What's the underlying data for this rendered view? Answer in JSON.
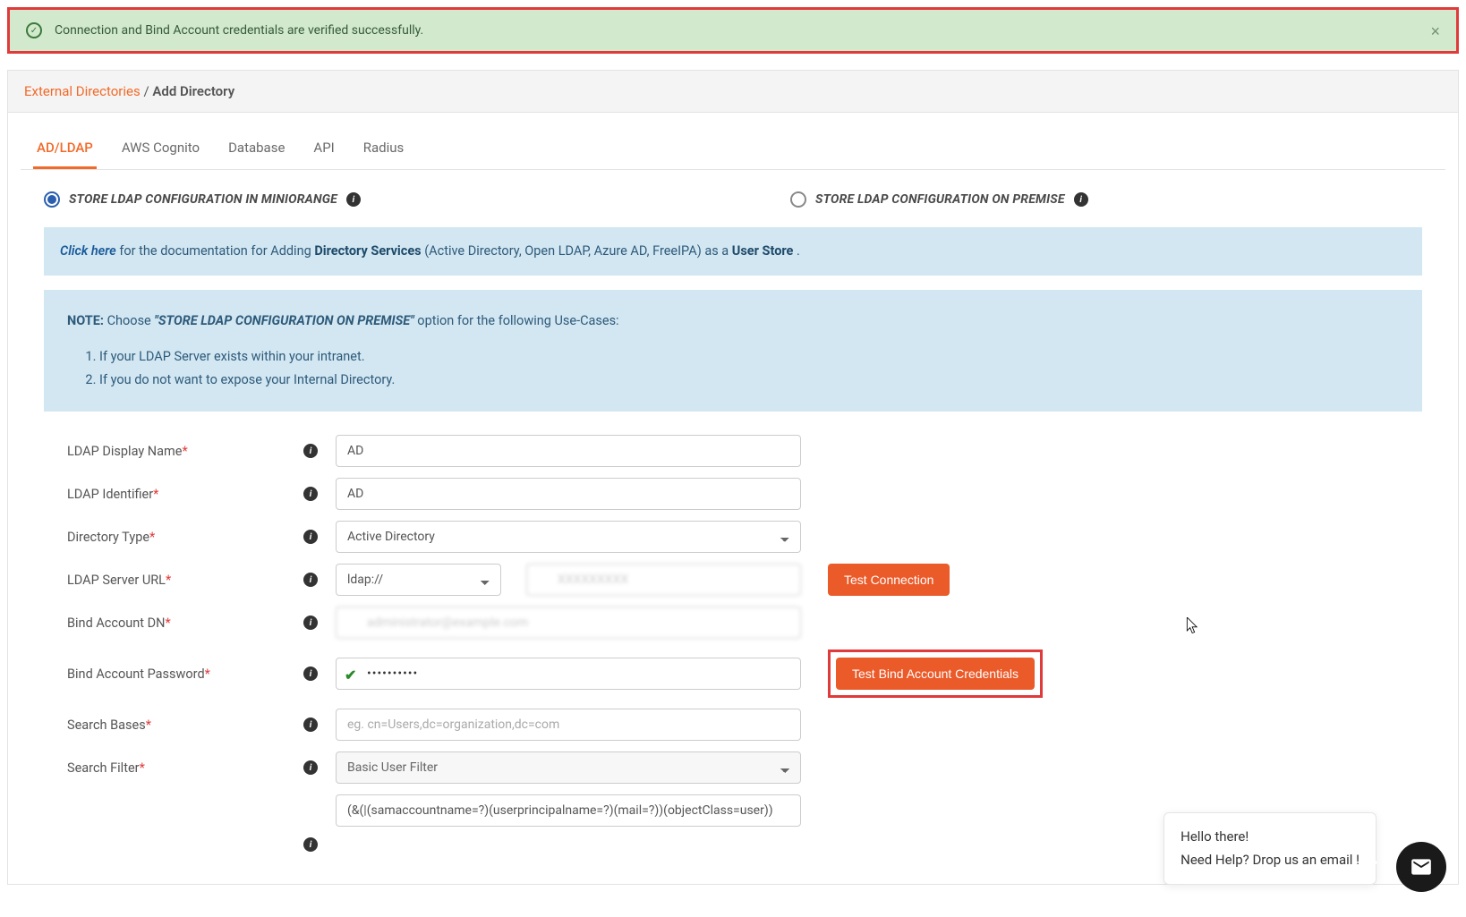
{
  "alert": {
    "text": "Connection and Bind Account credentials are verified successfully."
  },
  "breadcrumb": {
    "parent": "External Directories",
    "sep": " / ",
    "current": "Add Directory"
  },
  "tabs": [
    "AD/LDAP",
    "AWS Cognito",
    "Database",
    "API",
    "Radius"
  ],
  "radio": {
    "miniorange": "STORE LDAP CONFIGURATION IN MINIORANGE",
    "onprem": "STORE LDAP CONFIGURATION ON PREMISE"
  },
  "docbox": {
    "click_here": "Click here",
    "text1": " for the documentation for Adding ",
    "dir_services": "Directory Services",
    "text2": " (Active Directory, Open LDAP, Azure AD, FreeIPA) as a ",
    "user_store": "User Store",
    "text3": "."
  },
  "notebox": {
    "note_label": "NOTE:",
    "choose": "  Choose ",
    "emph": "\"STORE LDAP CONFIGURATION ON PREMISE\"",
    "after": " option for the following Use-Cases:",
    "li1": "If your LDAP Server exists within your intranet.",
    "li2": "If you do not want to expose your Internal Directory."
  },
  "form": {
    "display_name_label": "LDAP Display Name",
    "display_name_value": "AD",
    "identifier_label": "LDAP Identifier",
    "identifier_value": "AD",
    "dir_type_label": "Directory Type",
    "dir_type_value": "Active Directory",
    "server_url_label": "LDAP Server URL",
    "proto_value": "ldap://",
    "host_value": "XXXXXXXXX",
    "test_conn_btn": "Test Connection",
    "bind_dn_label": "Bind Account DN",
    "bind_dn_value": "administrator@example.com",
    "bind_pw_label": "Bind Account Password",
    "bind_pw_value": "••••••••••",
    "test_bind_btn": "Test Bind Account Credentials",
    "search_bases_label": "Search Bases",
    "search_bases_placeholder": "eg. cn=Users,dc=organization,dc=com",
    "search_filter_label": "Search Filter",
    "search_filter_select": "Basic User Filter",
    "search_filter_value": "(&(|(samaccountname=?)(userprincipalname=?)(mail=?))(objectClass=user))"
  },
  "chat": {
    "line1": "Hello there!",
    "line2": "Need Help? Drop us an email !"
  }
}
